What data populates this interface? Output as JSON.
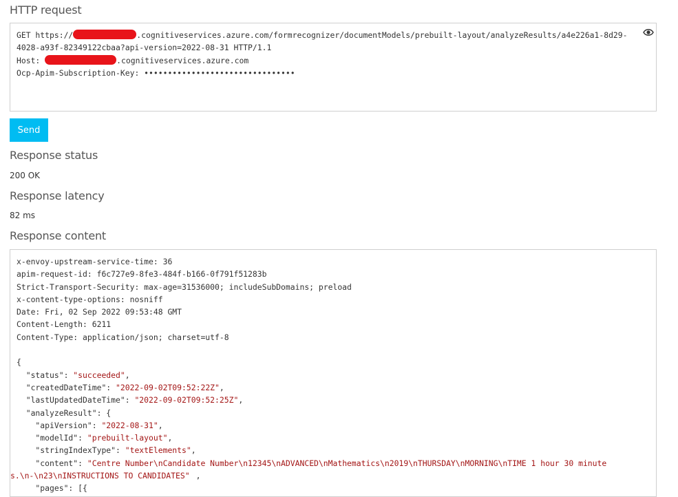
{
  "http_request": {
    "heading": "HTTP request",
    "line1_prefix": "GET https://",
    "line1_suffix": ".cognitiveservices.azure.com/formrecognizer/documentModels/prebuilt-layout/analyzeResults/a4e226a1-8d29-",
    "line2": "4028-a93f-82349122cbaa?api-version=2022-08-31 HTTP/1.1",
    "host_prefix": "Host: ",
    "host_suffix": ".cognitiveservices.azure.com",
    "key_line": "Ocp-Apim-Subscription-Key: ••••••••••••••••••••••••••••••••",
    "reveal_icon": "eye-icon"
  },
  "send_label": "Send",
  "response_status": {
    "heading": "Response status",
    "value": "200 OK"
  },
  "response_latency": {
    "heading": "Response latency",
    "value": "82 ms"
  },
  "response_content": {
    "heading": "Response content",
    "headers": [
      "x-envoy-upstream-service-time: 36",
      "apim-request-id: f6c727e9-8fe3-484f-b166-0f791f51283b",
      "Strict-Transport-Security: max-age=31536000; includeSubDomains; preload",
      "x-content-type-options: nosniff",
      "Date: Fri, 02 Sep 2022 09:53:48 GMT",
      "Content-Length: 6211",
      "Content-Type: application/json; charset=utf-8"
    ],
    "json_open": "{",
    "status_key": "  \"status\": ",
    "status_val": "\"succeeded\"",
    "created_key": "  \"createdDateTime\": ",
    "created_val": "\"2022-09-02T09:52:22Z\"",
    "updated_key": "  \"lastUpdatedDateTime\": ",
    "updated_val": "\"2022-09-02T09:52:25Z\"",
    "analyze_key": "  \"analyzeResult\": {",
    "api_key": "    \"apiVersion\": ",
    "api_val": "\"2022-08-31\"",
    "model_key": "    \"modelId\": ",
    "model_val": "\"prebuilt-layout\"",
    "sit_key": "    \"stringIndexType\": ",
    "sit_val": "\"textElements\"",
    "content_key": "    \"content\": ",
    "content_val_1": "\"Centre Number\\nCandidate Number\\n12345\\nADVANCED\\nMathematics\\n2019\\nTHURSDAY\\nMORNING\\nTIME 1 hour 30 minute",
    "content_val_2": "s.\\n-\\n23\\nINSTRUCTIONS TO CANDIDATES\"",
    "pages_key": "    \"pages\": [{"
  }
}
